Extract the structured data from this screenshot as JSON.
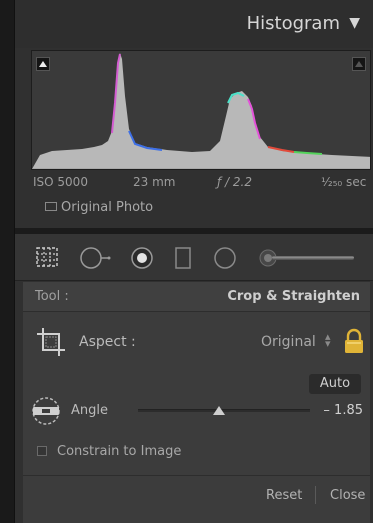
{
  "histogram": {
    "title": "Histogram",
    "toggle_icon": "triangle-down-icon",
    "exif": {
      "iso": "ISO 5000",
      "focal_length": "23 mm",
      "aperture": "ƒ / 2.2",
      "shutter": "¹⁄₂₅₀ sec"
    },
    "original_photo_label": "Original Photo"
  },
  "tool_strip": {
    "icons": [
      "crop-grid-icon",
      "spot-removal-icon",
      "red-eye-icon",
      "graduated-filter-icon",
      "radial-filter-icon",
      "adjustment-brush-icon"
    ]
  },
  "tool_panel": {
    "tool_label": "Tool :",
    "tool_value": "Crop & Straighten",
    "aspect_label": "Aspect :",
    "aspect_value": "Original",
    "auto_label": "Auto",
    "angle_label": "Angle",
    "angle_value": "– 1.85",
    "angle_slider_fraction": 0.47,
    "constrain_label": "Constrain to Image",
    "reset_label": "Reset",
    "close_label": "Close"
  },
  "colors": {
    "panel_bg": "#3c3c3c",
    "lock_gold": "#e0b437"
  }
}
